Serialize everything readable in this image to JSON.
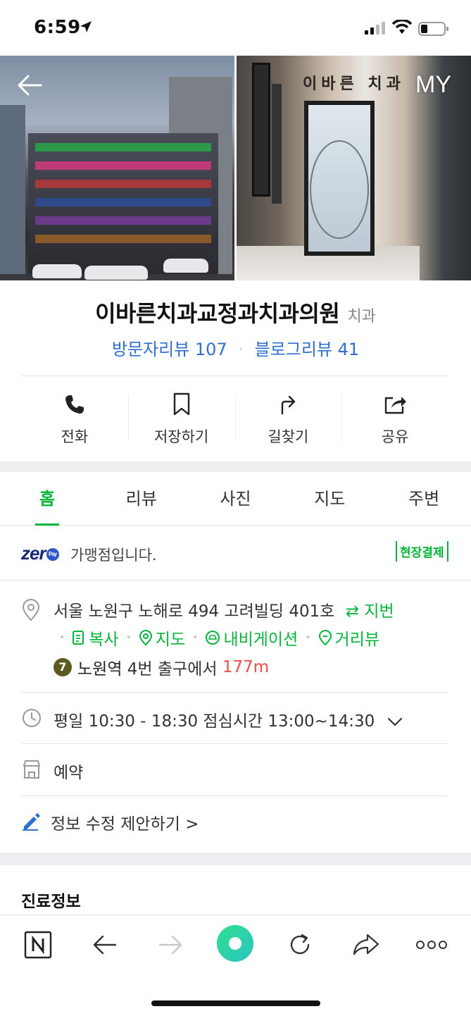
{
  "status_bar": {
    "time": "6:59"
  },
  "hero": {
    "back_label": "back",
    "my_label": "MY",
    "sign_text": "이바른 치과"
  },
  "place": {
    "name": "이바른치과교정과치과의원",
    "category": "치과",
    "visitor_review": "방문자리뷰 107",
    "blog_review": "블로그리뷰 41"
  },
  "actions": [
    {
      "label": "전화",
      "icon": "phone-icon"
    },
    {
      "label": "저장하기",
      "icon": "bookmark-icon"
    },
    {
      "label": "길찾기",
      "icon": "directions-icon"
    },
    {
      "label": "공유",
      "icon": "share-icon"
    }
  ],
  "tabs": [
    {
      "label": "홈",
      "active": true
    },
    {
      "label": "리뷰",
      "active": false
    },
    {
      "label": "사진",
      "active": false
    },
    {
      "label": "지도",
      "active": false
    },
    {
      "label": "주변",
      "active": false
    }
  ],
  "zeropay": {
    "logo": "zer",
    "pay_mark": "Pay",
    "text": "가맹점입니다.",
    "badge": "현장결제"
  },
  "address": {
    "text": "서울 노원구 노해로 494 고려빌딩 401호",
    "jibun": "지번",
    "links": [
      "복사",
      "지도",
      "내비게이션",
      "거리뷰"
    ],
    "line_number": "7",
    "station": "노원역",
    "exit": "4번 출구에서",
    "distance": "177m"
  },
  "hours": {
    "text": "평일 10:30 - 18:30 점심시간 13:00~14:30"
  },
  "reservation": {
    "text": "예약"
  },
  "edit_suggest": {
    "text": "정보 수정 제안하기 >"
  },
  "section": {
    "title": "진료정보"
  },
  "bottom_nav": [
    "naver-home",
    "back",
    "forward",
    "green-dot",
    "refresh",
    "share",
    "more"
  ],
  "colors": {
    "accent_green": "#03b63a",
    "link_blue": "#2f6fd0",
    "distance_red": "#f14b4b",
    "zeropay_navy": "#14287a"
  }
}
